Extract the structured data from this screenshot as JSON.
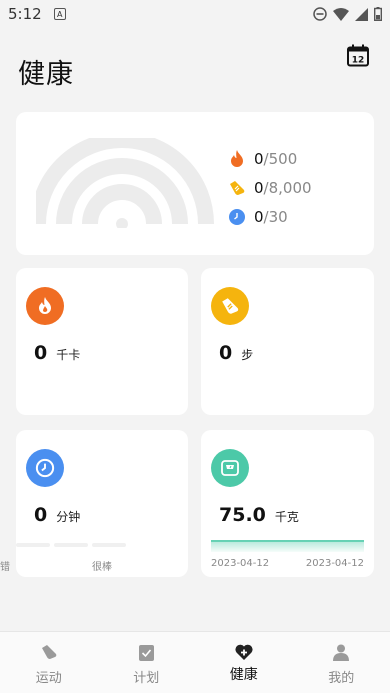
{
  "status_bar": {
    "time": "5:12"
  },
  "header": {
    "title": "健康",
    "calendar_day": "12"
  },
  "summary": {
    "calories": {
      "current": "0",
      "goal": "/500"
    },
    "steps": {
      "current": "0",
      "goal": "/8,000"
    },
    "minutes": {
      "current": "0",
      "goal": "/30"
    }
  },
  "tiles": {
    "calories": {
      "value": "0",
      "unit": "千卡"
    },
    "steps": {
      "value": "0",
      "unit": "步"
    },
    "minutes": {
      "value": "0",
      "unit": "分钟",
      "label_left": "错",
      "label_mid": "很棒"
    },
    "weight": {
      "value": "75.0",
      "unit": "千克",
      "date_start": "2023-04-12",
      "date_end": "2023-04-12"
    }
  },
  "tabbar": {
    "tabs": [
      {
        "label": "运动",
        "icon": "shoe-icon"
      },
      {
        "label": "计划",
        "icon": "plan-icon"
      },
      {
        "label": "健康",
        "icon": "health-icon"
      },
      {
        "label": "我的",
        "icon": "profile-icon"
      }
    ],
    "active": "健康"
  },
  "colors": {
    "calories": "#f06d23",
    "steps": "#f5b40e",
    "minutes": "#4a8ff0",
    "weight": "#4cc9a8"
  }
}
